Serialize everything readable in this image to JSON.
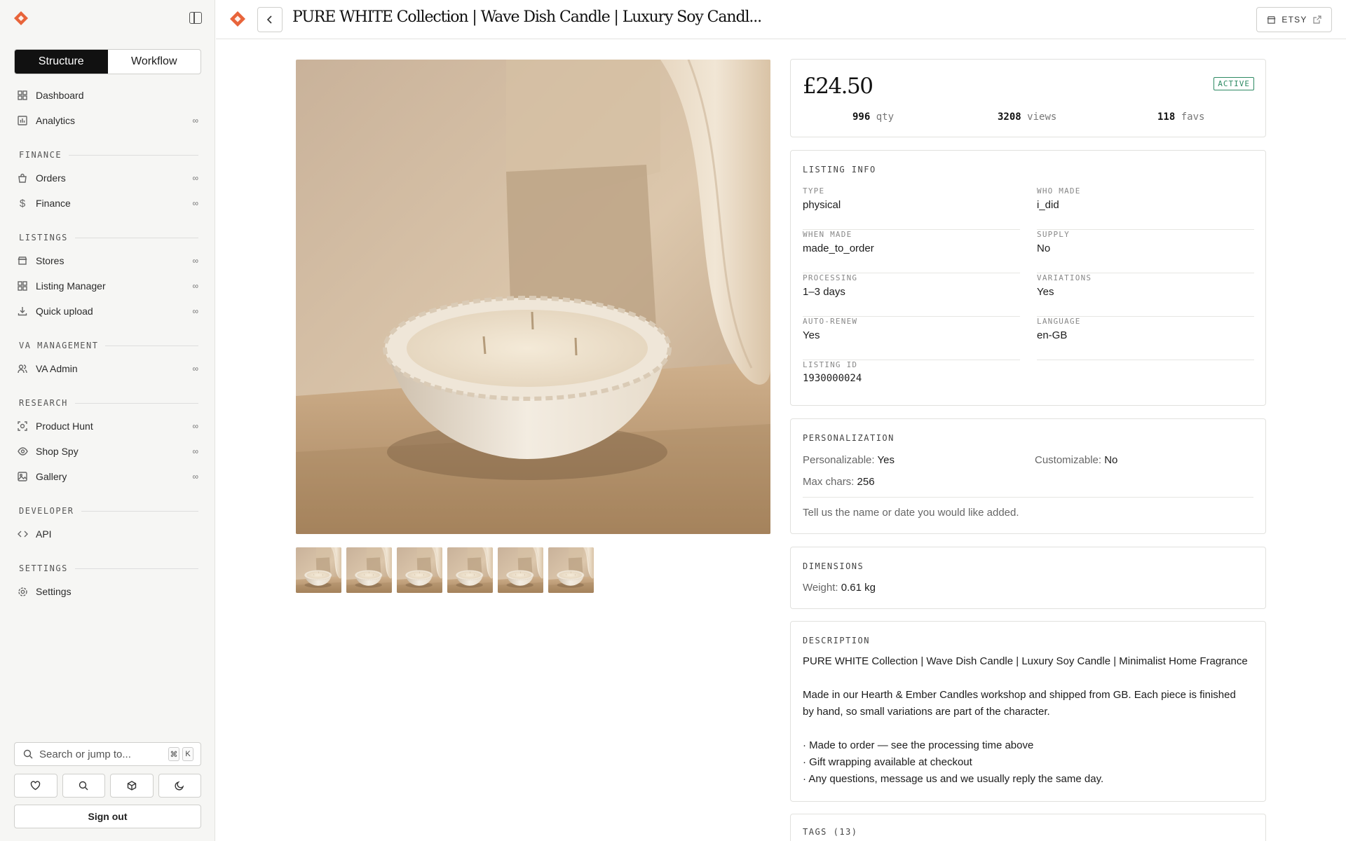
{
  "sidebar": {
    "segments": [
      "Structure",
      "Workflow"
    ],
    "top_items": [
      {
        "label": "Dashboard",
        "icon": "grid-icon",
        "badge": ""
      },
      {
        "label": "Analytics",
        "icon": "bar-chart-icon",
        "badge": "∞"
      }
    ],
    "sections": [
      {
        "title": "FINANCE",
        "items": [
          {
            "label": "Orders",
            "icon": "bag-icon",
            "badge": "∞"
          },
          {
            "label": "Finance",
            "icon": "dollar-icon",
            "badge": "∞"
          }
        ]
      },
      {
        "title": "LISTINGS",
        "items": [
          {
            "label": "Stores",
            "icon": "store-icon",
            "badge": "∞"
          },
          {
            "label": "Listing Manager",
            "icon": "grid-icon",
            "badge": "∞"
          },
          {
            "label": "Quick upload",
            "icon": "download-icon",
            "badge": "∞"
          }
        ]
      },
      {
        "title": "VA MANAGEMENT",
        "items": [
          {
            "label": "VA Admin",
            "icon": "users-icon",
            "badge": "∞"
          }
        ]
      },
      {
        "title": "RESEARCH",
        "items": [
          {
            "label": "Product Hunt",
            "icon": "target-icon",
            "badge": "∞"
          },
          {
            "label": "Shop Spy",
            "icon": "eye-icon",
            "badge": "∞"
          },
          {
            "label": "Gallery",
            "icon": "image-icon",
            "badge": "∞"
          }
        ]
      },
      {
        "title": "DEVELOPER",
        "items": [
          {
            "label": "API",
            "icon": "code-icon",
            "badge": ""
          }
        ]
      },
      {
        "title": "SETTINGS",
        "items": [
          {
            "label": "Settings",
            "icon": "gear-icon",
            "badge": ""
          }
        ]
      }
    ],
    "search_placeholder": "Search or jump to...",
    "search_kbd": [
      "⌘",
      "K"
    ],
    "sign_out": "Sign out"
  },
  "topbar": {
    "title": "PURE WHITE Collection | Wave Dish Candle | Luxury Soy Candl...",
    "etsy_label": "ETSY"
  },
  "summary": {
    "price": "£24.50",
    "status": "ACTIVE",
    "qty_value": "996",
    "qty_unit": "qty",
    "views_value": "3208",
    "views_unit": "views",
    "favs_value": "118",
    "favs_unit": "favs"
  },
  "listing_info": {
    "title": "LISTING INFO",
    "fields": [
      {
        "key": "TYPE",
        "value": "physical"
      },
      {
        "key": "WHO MADE",
        "value": "i_did"
      },
      {
        "key": "WHEN MADE",
        "value": "made_to_order"
      },
      {
        "key": "SUPPLY",
        "value": "No"
      },
      {
        "key": "PROCESSING",
        "value": "1–3 days"
      },
      {
        "key": "VARIATIONS",
        "value": "Yes"
      },
      {
        "key": "AUTO-RENEW",
        "value": "Yes"
      },
      {
        "key": "LANGUAGE",
        "value": "en-GB"
      },
      {
        "key": "LISTING ID",
        "value": "1930000024"
      }
    ]
  },
  "personalization": {
    "title": "PERSONALIZATION",
    "personalizable_label": "Personalizable:",
    "personalizable_value": "Yes",
    "customizable_label": "Customizable:",
    "customizable_value": "No",
    "max_chars_label": "Max chars:",
    "max_chars_value": "256",
    "instructions": "Tell us the name or date you would like added."
  },
  "dimensions": {
    "title": "DIMENSIONS",
    "weight_label": "Weight:",
    "weight_value": "0.61 kg"
  },
  "description": {
    "title": "DESCRIPTION",
    "lines": [
      "PURE WHITE Collection | Wave Dish Candle | Luxury Soy Candle | Minimalist Home Fragrance",
      "",
      "Made in our Hearth & Ember Candles workshop and shipped from GB. Each piece is finished",
      "by hand, so small variations are part of the character.",
      "",
      "· Made to order — see the processing time above",
      "· Gift wrapping available at checkout",
      "· Any questions, message us and we usually reply the same day."
    ]
  },
  "tags": {
    "title": "TAGS (13)"
  },
  "colors": {
    "brand": "#e8643a",
    "active": "#2e8a63"
  }
}
